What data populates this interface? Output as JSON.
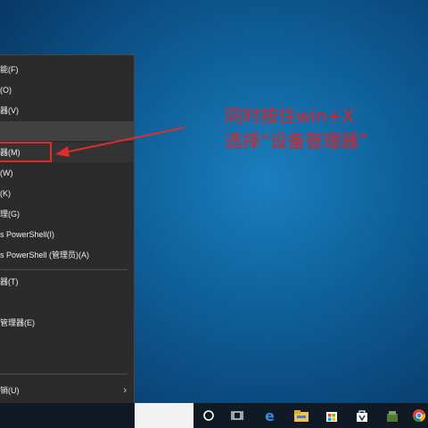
{
  "menu": {
    "items": [
      {
        "label": "能(F)"
      },
      {
        "label": "(O)"
      },
      {
        "label": "器(V)"
      },
      {
        "label": ""
      },
      {
        "label": "器(M)"
      },
      {
        "label": "(W)"
      },
      {
        "label": "(K)"
      },
      {
        "label": "理(G)"
      },
      {
        "label": "s PowerShell(I)"
      },
      {
        "label": "s PowerShell (管理员)(A)"
      },
      {
        "label": "器(T)"
      },
      {
        "label": "管理器(E)"
      },
      {
        "label": ""
      },
      {
        "label": "销(U)"
      },
      {
        "label": ""
      }
    ],
    "submenu_indicator": "›"
  },
  "annotation": {
    "line1": "同时按住win+X",
    "line2": "选择“设备管理器”",
    "color": "#e51f1f"
  },
  "taskbar": {
    "icons": [
      "cortana-icon",
      "task-view-icon",
      "edge-icon",
      "file-explorer-icon",
      "store-icon",
      "store-bag-icon",
      "app-icon",
      "chrome-icon"
    ]
  }
}
